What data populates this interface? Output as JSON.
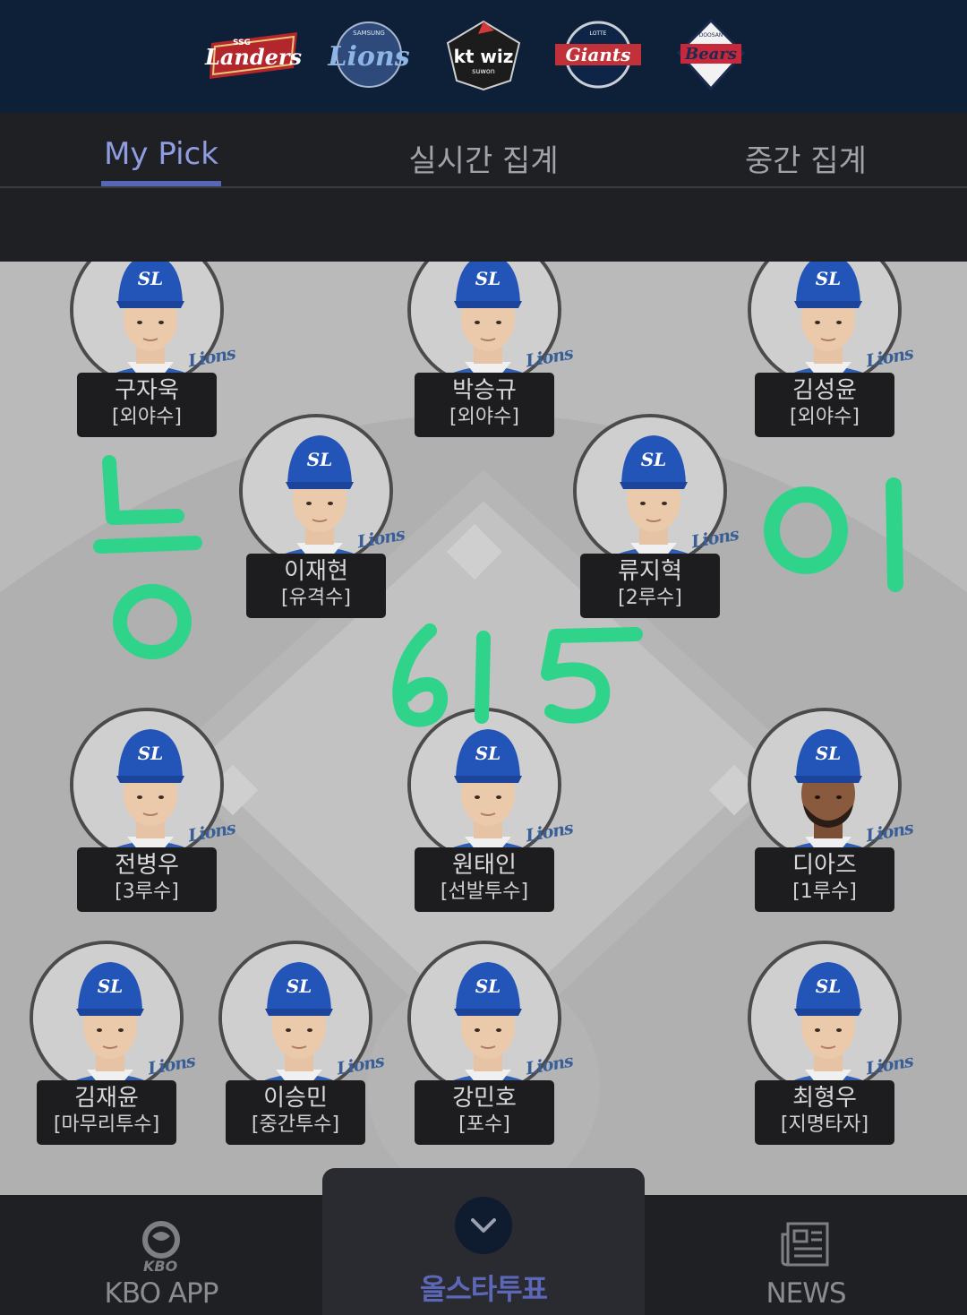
{
  "teams": [
    {
      "name": "Landers",
      "sub": "SSG",
      "icon": "ssg-landers-logo"
    },
    {
      "name": "Lions",
      "sub": "SAMSUNG",
      "icon": "samsung-lions-logo"
    },
    {
      "name": "kt wiz",
      "sub": "suwon",
      "icon": "kt-wiz-logo"
    },
    {
      "name": "Giants",
      "sub": "LOTTE",
      "icon": "lotte-giants-logo"
    },
    {
      "name": "Bears",
      "sub": "DOOSAN",
      "icon": "doosan-bears-logo"
    }
  ],
  "tabs": [
    {
      "label": "My Pick",
      "active": true
    },
    {
      "label": "실시간 집계",
      "active": false
    },
    {
      "label": "중간 집계",
      "active": false
    }
  ],
  "players": [
    {
      "name": "구자욱",
      "position": "[외야수]"
    },
    {
      "name": "박승규",
      "position": "[외야수]"
    },
    {
      "name": "김성윤",
      "position": "[외야수]"
    },
    {
      "name": "이재현",
      "position": "[유격수]"
    },
    {
      "name": "류지혁",
      "position": "[2루수]"
    },
    {
      "name": "전병우",
      "position": "[3루수]"
    },
    {
      "name": "원태인",
      "position": "[선발투수]"
    },
    {
      "name": "디아즈",
      "position": "[1루수]"
    },
    {
      "name": "김재윤",
      "position": "[마무리투수]"
    },
    {
      "name": "이승민",
      "position": "[중간투수]"
    },
    {
      "name": "강민호",
      "position": "[포수]"
    },
    {
      "name": "최형우",
      "position": "[지명타자]"
    }
  ],
  "team_tag": "Lions",
  "cap_logo": "SL",
  "handwriting": {
    "left": "둥",
    "right": "이",
    "middle": "615",
    "color": "#2fd48a"
  },
  "nav": {
    "left_label": "KBO APP",
    "left_logo_text": "KBO",
    "center_label": "올스타투표",
    "right_label": "NEWS"
  }
}
